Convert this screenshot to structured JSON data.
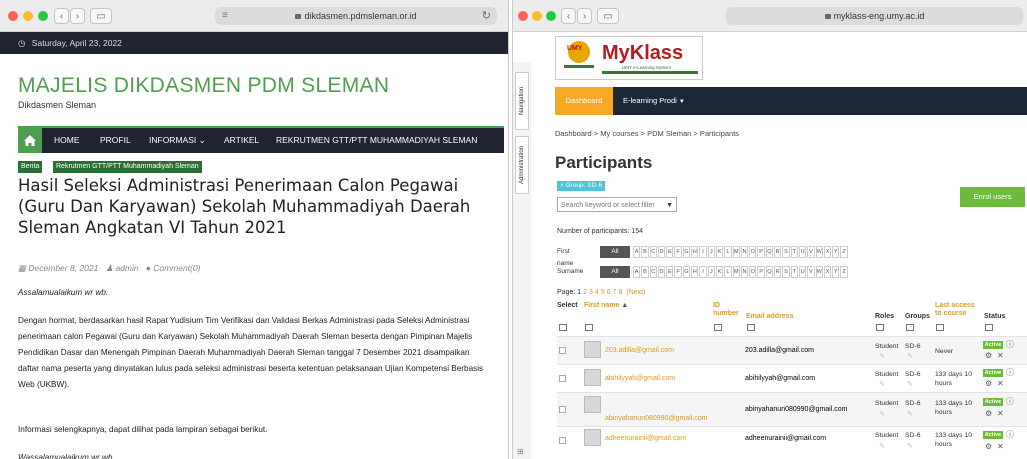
{
  "left": {
    "browser": {
      "url": "dikdasmen.pdmsleman.or.id"
    },
    "topbar": {
      "date": "Saturday, April 23, 2022"
    },
    "site": {
      "title": "MAJELIS DIKDASMEN PDM SLEMAN",
      "subtitle": "Dikdasmen Sleman"
    },
    "nav": [
      "HOME",
      "PROFIL",
      "INFORMASI",
      "ARTIKEL",
      "REKRUTMEN GTT/PTT MUHAMMADIYAH SLEMAN"
    ],
    "categories": [
      "Berita",
      "Rekrutmen GTT/PTT Muhammadiyah Sleman"
    ],
    "post": {
      "title": "Hasil Seleksi Administrasi Penerimaan Calon Pegawai (Guru Dan Karyawan) Sekolah Muhammadiyah Daerah Sleman Angkatan VI Tahun 2021",
      "date": "December 8, 2021",
      "author": "admin",
      "comments": "Comment(0)",
      "greeting": "Assalamualaikum wr wb.",
      "body": "Dengan hormat, berdasarkan hasil Rapat Yudisium Tim Verifikasi dan Validasi Berkas Administrasi pada Seleksi Administrasi penerimaan calon Pegawai (Guru dan Karyawan) Sekolah Muhammadiyah Daerah Sleman beserta dengan Pimpinan Majelis Pendidikan Dasar dan Menengah Pimpinan Daerah Muhammadiyah Daerah Sleman tanggal 7 Desember 2021 disampaikan daftar nama peserta yang dinyatakan lulus pada seleksi administrasi beserta ketentuan pelaksanaan Ujian Kompetensi Berbasis Web (UKBW).",
      "info": "Informasi selengkapnya, dapat dilihat pada lampiran sebagai berikut.",
      "closing": "Wassalamualaikum wr wb."
    }
  },
  "right": {
    "browser": {
      "url": "myklass-eng.umy.ac.id"
    },
    "sidetabs": [
      "Navigation",
      "Administration"
    ],
    "logo": {
      "abbr": "UMY",
      "name": "MyKlass",
      "tagline": "UMY e-Learning System"
    },
    "nav": {
      "active": "Dashboard",
      "prodi": "E-learning Prodi"
    },
    "breadcrumb": "Dashboard > My courses > PDM Sleman > Participants",
    "page_title": "Participants",
    "group_tag": "× Group: SD-6",
    "keyword_placeholder": "Search keyword or select filter",
    "enrol_button": "Enrol users",
    "num_participants": "Number of participants: 154",
    "filter": {
      "first_label": "First name",
      "surname_label": "Surname",
      "all": "All",
      "letters": [
        "A",
        "B",
        "C",
        "D",
        "E",
        "F",
        "G",
        "H",
        "I",
        "J",
        "K",
        "L",
        "M",
        "N",
        "O",
        "P",
        "Q",
        "R",
        "S",
        "T",
        "U",
        "V",
        "W",
        "X",
        "Y",
        "Z"
      ]
    },
    "pagination": {
      "label": "Page:",
      "current": "1",
      "pages": [
        "2",
        "3",
        "4",
        "5",
        "6",
        "7",
        "8"
      ],
      "next": "(Next)"
    },
    "table": {
      "headers": {
        "select": "Select",
        "firstname": "First name",
        "idnumber": "ID number",
        "email": "Email address",
        "roles": "Roles",
        "groups": "Groups",
        "lastaccess": "Last access to course",
        "status": "Status"
      },
      "rows": [
        {
          "name": "203.adilla@gmail.com",
          "email": "203.adilla@gmail.com",
          "role": "Student",
          "group": "SD-6",
          "last": "Never",
          "status": "Active"
        },
        {
          "name": "abihilyyah@gmail.com",
          "email": "abihilyyah@gmail.com",
          "role": "Student",
          "group": "SD-6",
          "last": "133 days 10 hours",
          "status": "Active"
        },
        {
          "name": "abinyahanun080990@gmail.com",
          "email": "abinyahanun080990@gmail.com",
          "role": "Student",
          "group": "SD-6",
          "last": "133 days 10 hours",
          "status": "Active"
        },
        {
          "name": "adheenurainii@gmail.com",
          "email": "adheenurainii@gmail.com",
          "role": "Student",
          "group": "SD-6",
          "last": "133 days 10 hours",
          "status": "Active"
        }
      ]
    }
  }
}
